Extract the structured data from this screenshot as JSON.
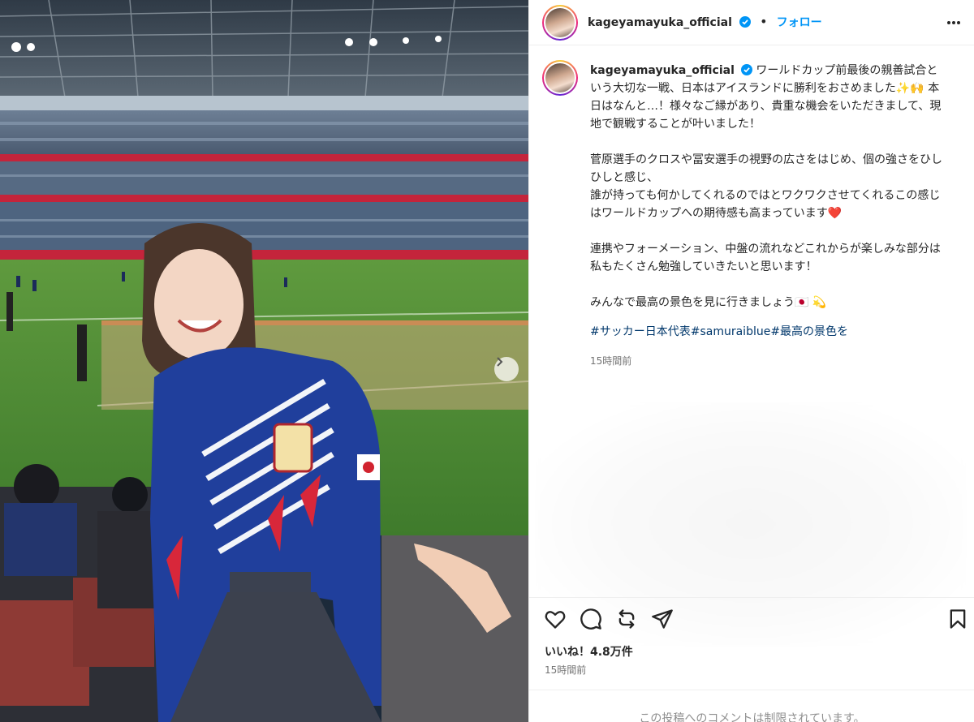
{
  "post": {
    "username": "kageyamayuka_official",
    "follow_label": "フォロー",
    "separator": "•",
    "caption_paragraphs": [
      "ワールドカップ前最後の親善試合という大切な一戦、日本はアイスランドに勝利をおさめました✨🙌 本日はなんと…！様々なご縁があり、貴重な機会をいただきまして、現地で観戦することが叶いました！",
      "菅原選手のクロスや冨安選手の視野の広さをはじめ、個の強さをひしひしと感じ、\n誰が持っても何かしてくれるのではとワクワクさせてくれるこの感じはワールドカップへの期待感も高まっています❤️",
      "連携やフォーメーション、中盤の流れなどこれからが楽しみな部分は私もたくさん勉強していきたいと思います！",
      "みんなで最高の景色を見に行きましょう🇯🇵 💫"
    ],
    "hashtags": "#サッカー日本代表#samuraiblue#最高の景色を",
    "caption_time": "15時間前",
    "likes": "いいね！4.8万件",
    "posted_time": "15時間前",
    "comments_notice": "この投稿へのコメントは制限されています。"
  },
  "icons": {
    "verified": "verified-badge-icon",
    "more": "more-options-icon",
    "like": "heart-icon",
    "comment": "comment-icon",
    "repost": "repost-icon",
    "share": "share-icon",
    "save": "bookmark-icon",
    "next": "chevron-right-icon"
  },
  "colors": {
    "follow": "#0095f6",
    "hashtag": "#00376b",
    "muted": "#737373",
    "verified": "#0095f6"
  }
}
